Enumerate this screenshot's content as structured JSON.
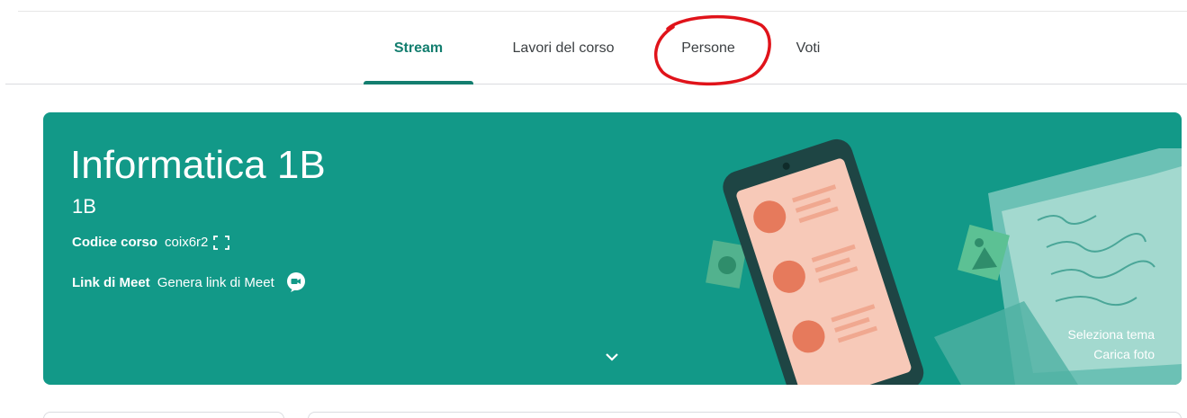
{
  "tabs": {
    "stream": "Stream",
    "lavori": "Lavori del corso",
    "persone": "Persone",
    "voti": "Voti"
  },
  "course": {
    "title": "Informatica 1B",
    "section": "1B",
    "code_label": "Codice corso",
    "code_value": "coix6r2",
    "meet_label": "Link di Meet",
    "meet_link": "Genera link di Meet"
  },
  "banner_actions": {
    "select_theme": "Seleziona tema",
    "upload_photo": "Carica foto"
  },
  "icons": {
    "fullscreen": "fullscreen-icon",
    "meet": "meet-video-icon",
    "expand": "chevron-down-icon"
  },
  "colors": {
    "accent": "#137e6f",
    "banner": "#129988",
    "annotation": "#e0131a"
  }
}
